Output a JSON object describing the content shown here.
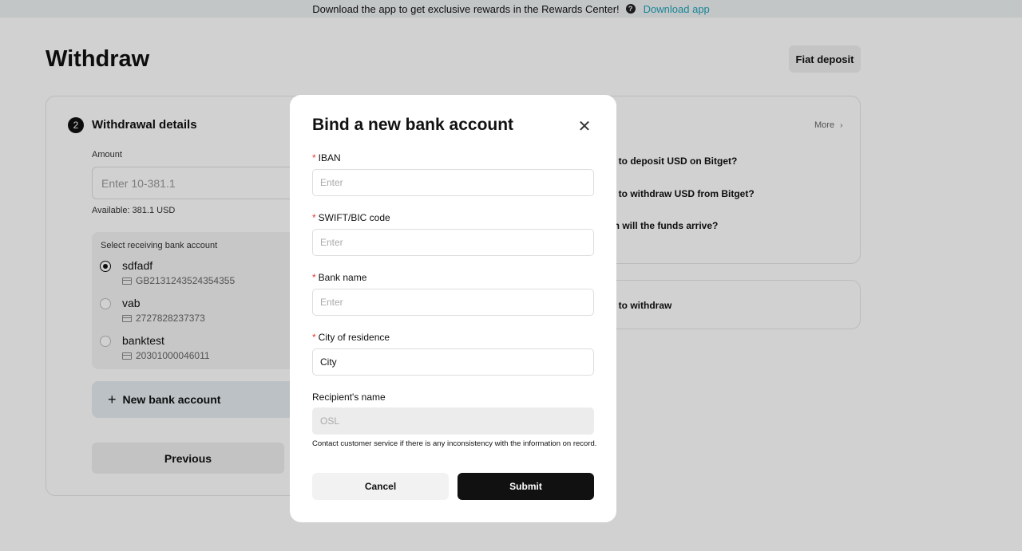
{
  "banner": {
    "text": "Download the app to get exclusive rewards in the Rewards Center!",
    "link": "Download app"
  },
  "page": {
    "title": "Withdraw",
    "fiat_deposit": "Fiat deposit"
  },
  "details": {
    "step": "2",
    "title": "Withdrawal details",
    "amount_label": "Amount",
    "amount_placeholder": "Enter 10-381.1",
    "available": "Available: 381.1 USD",
    "bank_box_label": "Select receiving bank account",
    "accounts": [
      {
        "name": "sdfadf",
        "number": "GB2131243524354355",
        "selected": true
      },
      {
        "name": "vab",
        "number": "2727828237373",
        "selected": false
      },
      {
        "name": "banktest",
        "number": "20301000046011",
        "selected": false
      }
    ],
    "new_bank": "New bank account",
    "previous": "Previous"
  },
  "faq": {
    "more": "More",
    "items": [
      "w to deposit USD on Bitget?",
      "w to withdraw USD from Bitget?",
      "en will the funds arrive?"
    ],
    "guide": "w to withdraw"
  },
  "modal": {
    "title": "Bind a new bank account",
    "fields": [
      {
        "label": "IBAN",
        "placeholder": "Enter",
        "value": "",
        "required": true
      },
      {
        "label": "SWIFT/BIC code",
        "placeholder": "Enter",
        "value": "",
        "required": true
      },
      {
        "label": "Bank name",
        "placeholder": "Enter",
        "value": "",
        "required": true
      },
      {
        "label": "City of residence",
        "placeholder": "",
        "value": "City",
        "required": true
      },
      {
        "label": "Recipient's name",
        "placeholder": "OSL",
        "value": "",
        "required": false
      }
    ],
    "note": "Contact customer service if there is any inconsistency with the information on record.",
    "cancel": "Cancel",
    "submit": "Submit"
  }
}
